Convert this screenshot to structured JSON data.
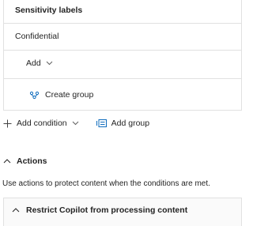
{
  "condition_group": {
    "header": "Sensitivity labels",
    "value": "Confidential",
    "add_label": "Add",
    "create_group_label": "Create group"
  },
  "toolbar": {
    "add_condition_label": "Add condition",
    "add_group_label": "Add group"
  },
  "actions": {
    "title": "Actions",
    "description": "Use actions to protect content when the conditions are met.",
    "items": [
      {
        "title": "Restrict Copilot from processing content"
      }
    ]
  },
  "colors": {
    "border": "#e1e1e1",
    "text": "#242424",
    "accent": "#0f6cbd"
  }
}
